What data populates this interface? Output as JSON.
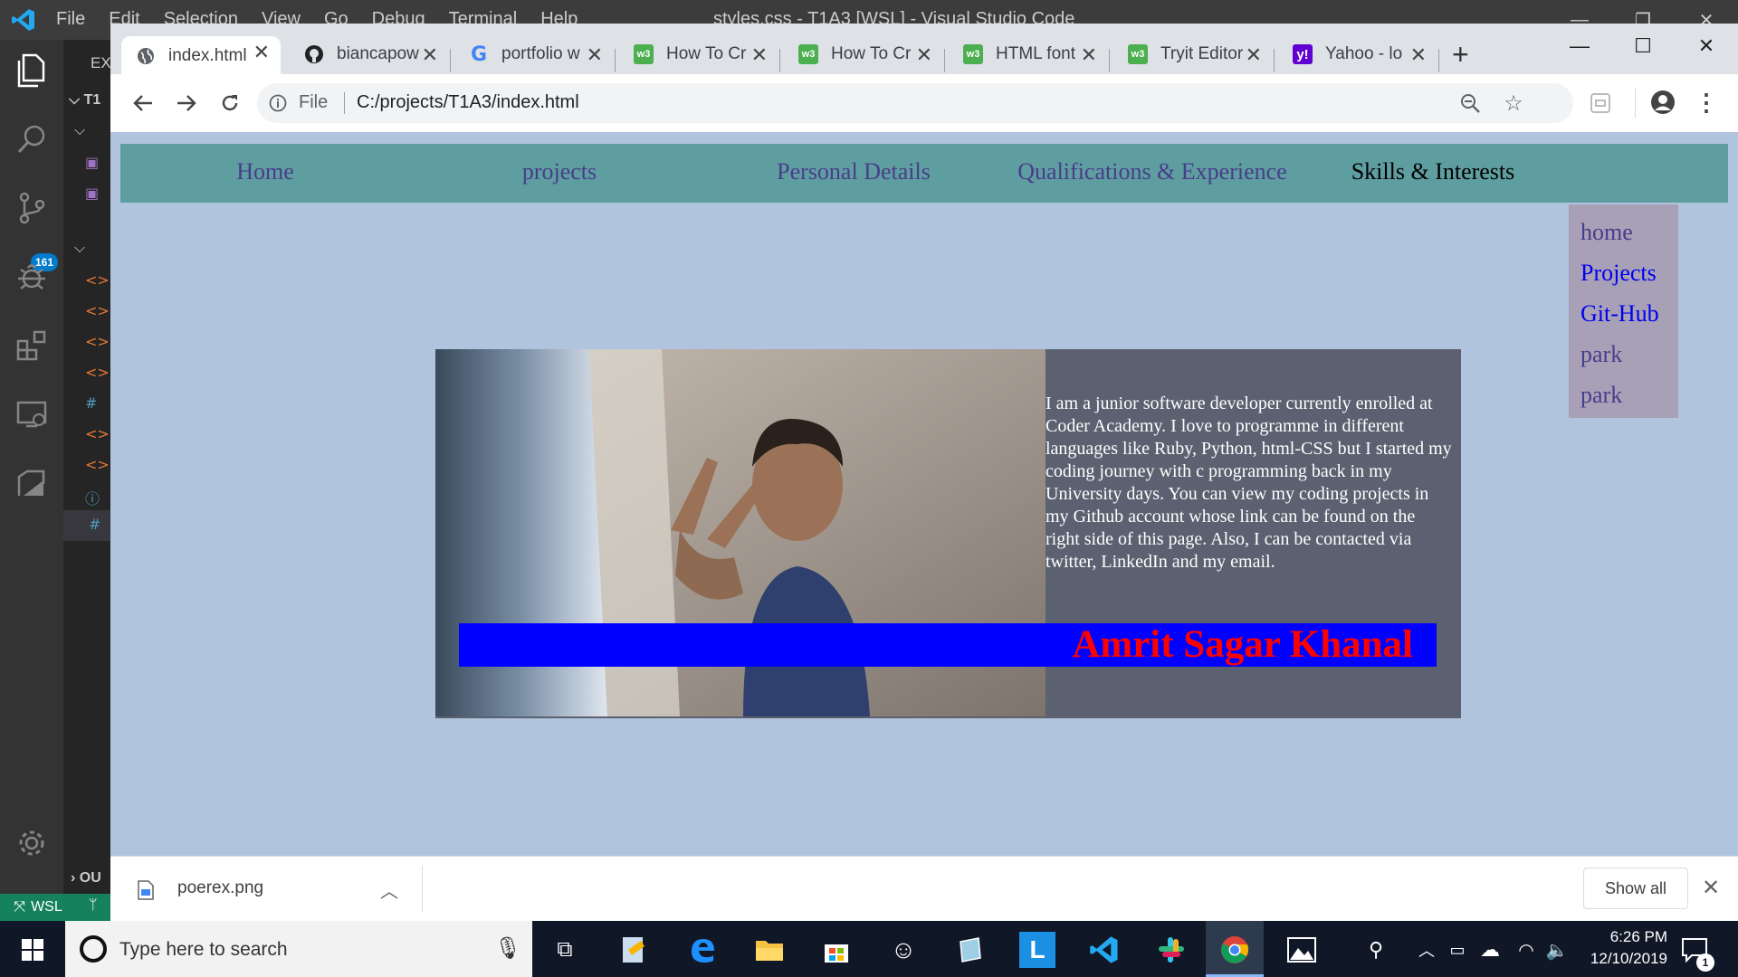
{
  "vscode": {
    "menu": [
      "File",
      "Edit",
      "Selection",
      "View",
      "Go",
      "Debug",
      "Terminal",
      "Help"
    ],
    "window_title": "styles.css - T1A3 [WSL] - Visual Studio Code",
    "explorer_abbrev": "EX",
    "folder_abbrev": "T1",
    "outline_abbrev": "OU",
    "scm_badge": "161",
    "status_remote": "WSL"
  },
  "chrome": {
    "tabs": [
      {
        "title": "index.html",
        "icon": "globe-icon"
      },
      {
        "title": "biancapow",
        "icon": "github-icon"
      },
      {
        "title": "portfolio w",
        "icon": "google-icon"
      },
      {
        "title": "How To Cr",
        "icon": "w3schools-icon"
      },
      {
        "title": "How To Cr",
        "icon": "w3schools-icon"
      },
      {
        "title": "HTML font",
        "icon": "w3schools-icon"
      },
      {
        "title": "Tryit Editor",
        "icon": "w3schools-icon"
      },
      {
        "title": "Yahoo - lo",
        "icon": "yahoo-icon"
      }
    ],
    "omnibox": {
      "scheme_label": "File",
      "url": "C:/projects/T1A3/index.html"
    },
    "download": {
      "file_name": "poerex.png",
      "show_all": "Show all"
    }
  },
  "page": {
    "nav": [
      "Home",
      "projects",
      "Personal Details",
      "Qualifications & Experience",
      "Skills & Interests"
    ],
    "side_links": [
      "home",
      "Projects",
      "Git-Hub",
      "park",
      "park"
    ],
    "bio": "I am a junior software developer currently enrolled at Coder Academy. I love to programme in different languages like Ruby, Python, html-CSS but I started my coding journey with c programming back in my University days. You can view my coding projects in my Github account whose link can be found on the right side of this page. Also, I can be contacted via twitter, LinkedIn and my email.",
    "name": "Amrit Sagar Khanal"
  },
  "taskbar": {
    "search_placeholder": "Type here to search",
    "time": "6:26 PM",
    "date": "12/10/2019",
    "notification_count": "1"
  },
  "colors": {
    "page_bg": "#b0c4de",
    "nav_bg": "#5f9ea0",
    "nav_link": "#483d8b",
    "name_bar": "#0000ff",
    "name_text": "#ff0000"
  }
}
